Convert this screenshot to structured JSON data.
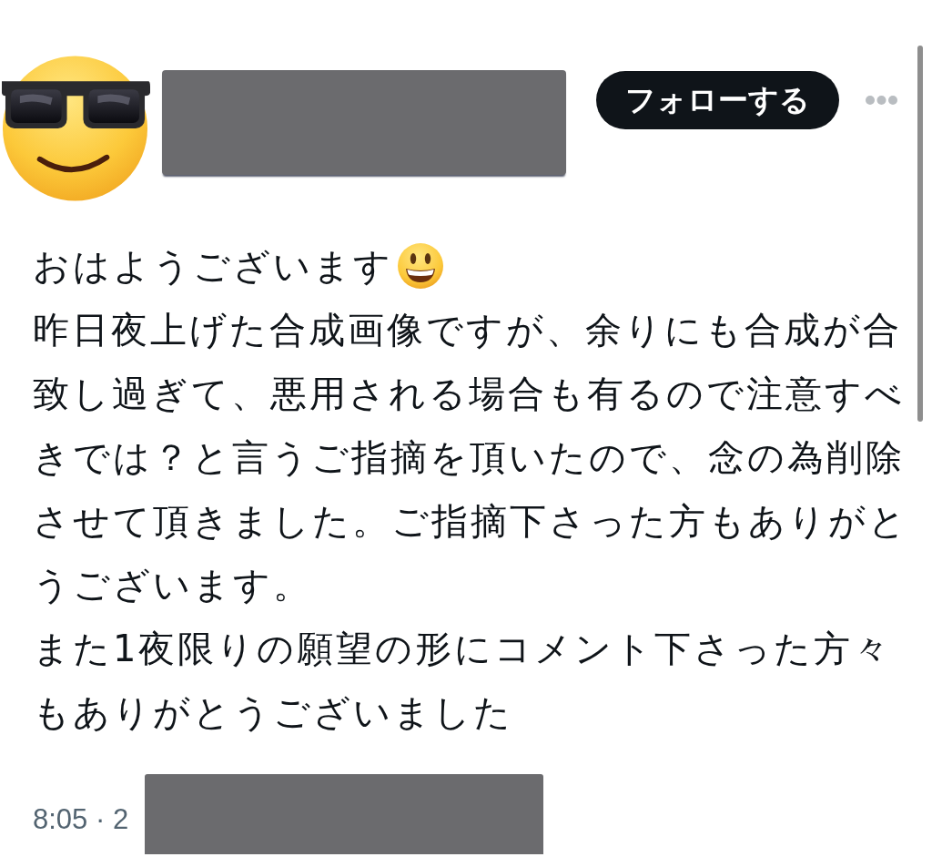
{
  "author": {
    "name_redacted": true,
    "follow_label": "フォローする"
  },
  "post": {
    "greeting": "おはようございます",
    "paragraphs": [
      "昨日夜上げた合成画像ですが、余りにも合成が合致し過ぎて、悪用される場合も有るので注意すべきでは？と言うご指摘を頂いたので、念の為削除させて頂きました。ご指摘下さった方もありがとうございます。",
      "また1夜限りの願望の形にコメント下さった方々もありがとうございました"
    ]
  },
  "meta": {
    "time": "8:05 · 2",
    "date_redacted": true
  }
}
